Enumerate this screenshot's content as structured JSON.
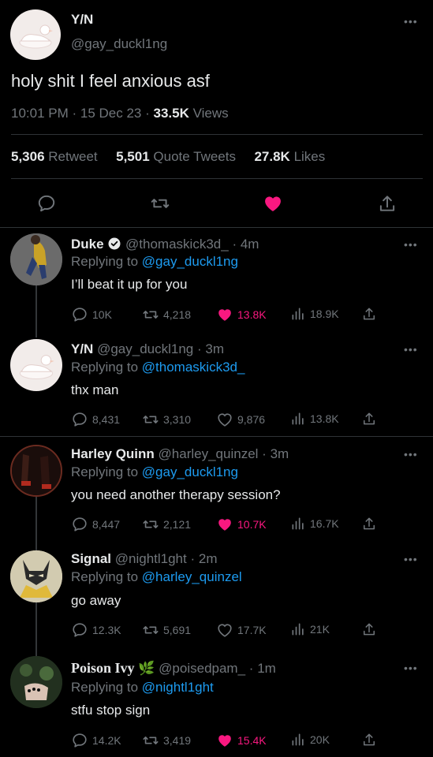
{
  "main": {
    "author_name": "Y/N",
    "author_handle": "@gay_duckl1ng",
    "text": "holy shit I feel anxious asf",
    "time": "10:01 PM",
    "date": "15 Dec 23",
    "views_count": "33.5K",
    "views_label": "Views",
    "retweets_count": "5,306",
    "retweets_label": "Retweet",
    "quotes_count": "5,501",
    "quotes_label": "Quote Tweets",
    "likes_count": "27.8K",
    "likes_label": "Likes",
    "liked": true
  },
  "replies": [
    {
      "name": "Duke",
      "verified": true,
      "handle": "@thomaskick3d_",
      "time": "4m",
      "replying_label": "Replying to",
      "replying_to": "@gay_duckl1ng",
      "text": "I’ll beat it up for you",
      "replies": "10K",
      "retweets": "4,218",
      "likes": "13.8K",
      "liked": true,
      "views": "18.9K"
    },
    {
      "name": "Y/N",
      "verified": false,
      "handle": "@gay_duckl1ng",
      "time": "3m",
      "replying_label": "Replying to",
      "replying_to": "@thomaskick3d_",
      "text": "thx man",
      "replies": "8,431",
      "retweets": "3,310",
      "likes": "9,876",
      "liked": false,
      "views": "13.8K"
    },
    {
      "name": "Harley Quinn",
      "verified": false,
      "handle": "@harley_quinzel",
      "time": "3m",
      "replying_label": "Replying to",
      "replying_to": "@gay_duckl1ng",
      "text": "you need another therapy session?",
      "replies": "8,447",
      "retweets": "2,121",
      "likes": "10.7K",
      "liked": true,
      "views": "16.7K"
    },
    {
      "name": "Signal",
      "verified": false,
      "handle": "@nightl1ght",
      "time": "2m",
      "replying_label": "Replying to",
      "replying_to": "@harley_quinzel",
      "text": "go away",
      "replies": "12.3K",
      "retweets": "5,691",
      "likes": "17.7K",
      "liked": false,
      "views": "21K"
    },
    {
      "name": "Poison Ivy",
      "emoji": "🌿",
      "verified": false,
      "handle": "@poisedpam_",
      "time": "1m",
      "replying_label": "Replying to",
      "replying_to": "@nightl1ght",
      "text": "stfu stop sign",
      "replies": "14.2K",
      "retweets": "3,419",
      "likes": "15.4K",
      "liked": true,
      "views": "20K"
    }
  ],
  "colors": {
    "accent": "#1d9bf0",
    "like": "#f91880",
    "muted": "#71767b",
    "background": "#000000"
  }
}
